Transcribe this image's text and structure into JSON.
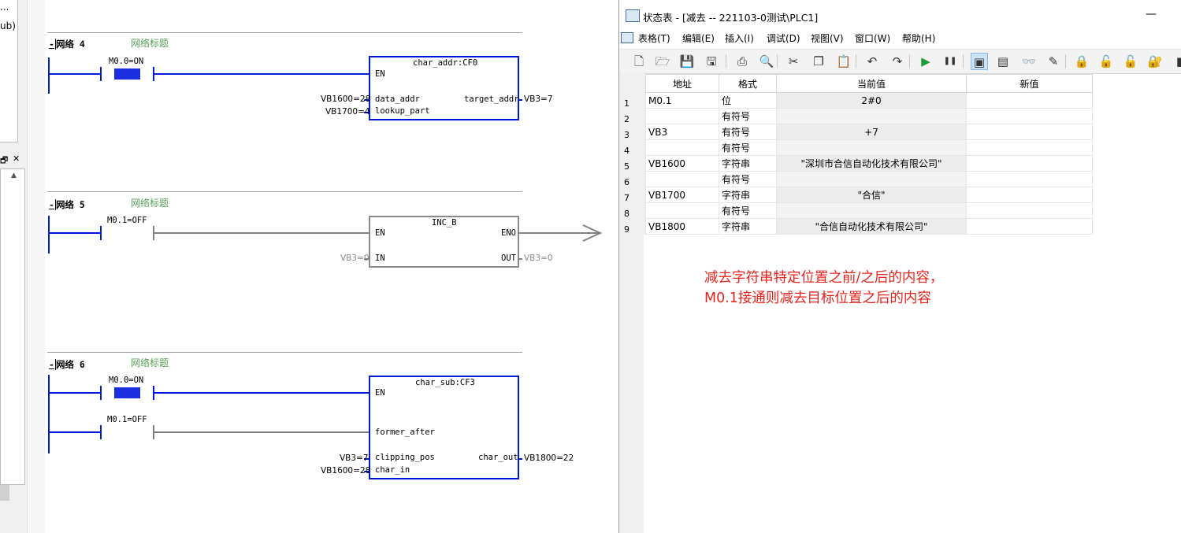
{
  "left_panel": {
    "cut_text_1": "...",
    "cut_text_2": "ub)",
    "restore_glyph": "🗗",
    "close_glyph": "✕",
    "scroll_up_glyph": "▲"
  },
  "networks": [
    {
      "label": "网络 4",
      "title": "网络标题",
      "contacts": [
        "M0.0=ON"
      ],
      "block": {
        "name": "char_addr:CF0",
        "pins_left": [
          "EN",
          "data_addr",
          "lookup_part"
        ],
        "pins_right": [
          "target_addr"
        ],
        "inputs": [
          "VB1600=28",
          "VB1700=4"
        ],
        "outputs": [
          "VB3=7"
        ]
      }
    },
    {
      "label": "网络 5",
      "title": "网络标题",
      "contacts": [
        "M0.1=OFF"
      ],
      "block": {
        "name": "INC_B",
        "pins_left": [
          "EN",
          "IN"
        ],
        "pins_right": [
          "ENO",
          "OUT"
        ],
        "inputs": [
          "VB3=0"
        ],
        "outputs": [
          "VB3=0"
        ]
      }
    },
    {
      "label": "网络 6",
      "title": "网络标题",
      "contacts": [
        "M0.0=ON",
        "M0.1=OFF"
      ],
      "block": {
        "name": "char_sub:CF3",
        "pins_left": [
          "EN",
          "former_after",
          "clipping_pos",
          "char_in"
        ],
        "pins_right": [
          "char_out"
        ],
        "inputs": [
          "VB3=7",
          "VB1600=28"
        ],
        "outputs": [
          "VB1800=22"
        ]
      }
    }
  ],
  "status_window": {
    "title": "状态表 - [减去 -- 221103-0测试\\PLC1]",
    "minimize_glyph": "—",
    "menu": [
      "表格(T)",
      "编辑(E)",
      "插入(I)",
      "调试(D)",
      "视图(V)",
      "窗口(W)",
      "帮助(H)"
    ],
    "toolbar_icons": [
      {
        "name": "new-icon",
        "glyph": "🗋"
      },
      {
        "name": "open-icon",
        "glyph": "🗁"
      },
      {
        "name": "save-icon",
        "glyph": "💾"
      },
      {
        "name": "save-all-icon",
        "glyph": "🖫"
      },
      {
        "name": "print-icon",
        "glyph": "⎙"
      },
      {
        "name": "print-preview-icon",
        "glyph": "🔍"
      },
      {
        "name": "cut-icon",
        "glyph": "✂"
      },
      {
        "name": "copy-icon",
        "glyph": "❐"
      },
      {
        "name": "paste-icon",
        "glyph": "📋"
      },
      {
        "name": "undo-icon",
        "glyph": "↶"
      },
      {
        "name": "redo-icon",
        "glyph": "↷"
      },
      {
        "name": "run-icon",
        "glyph": "▶"
      },
      {
        "name": "pause-icon",
        "glyph": "❚❚"
      },
      {
        "name": "table-monitor-icon",
        "glyph": "▣"
      },
      {
        "name": "single-read-icon",
        "glyph": "▤"
      },
      {
        "name": "glasses-icon",
        "glyph": "👓"
      },
      {
        "name": "pencil-icon",
        "glyph": "✎"
      },
      {
        "name": "force-icon",
        "glyph": "🔒"
      },
      {
        "name": "unforce-icon",
        "glyph": "🔓"
      },
      {
        "name": "unforce-all-icon",
        "glyph": "🔓"
      },
      {
        "name": "read-forced-icon",
        "glyph": "🔐"
      },
      {
        "name": "more-icon",
        "glyph": "▮"
      }
    ],
    "columns": [
      "地址",
      "格式",
      "当前值",
      "新值"
    ],
    "rows": [
      {
        "n": "1",
        "addr": "M0.1",
        "fmt": "位",
        "cur": "2#0",
        "new": ""
      },
      {
        "n": "2",
        "addr": "",
        "fmt": "有符号",
        "cur": "",
        "new": ""
      },
      {
        "n": "3",
        "addr": "VB3",
        "fmt": "有符号",
        "cur": "+7",
        "new": ""
      },
      {
        "n": "4",
        "addr": "",
        "fmt": "有符号",
        "cur": "",
        "new": ""
      },
      {
        "n": "5",
        "addr": "VB1600",
        "fmt": "字符串",
        "cur": "\"深圳市合信自动化技术有限公司\"",
        "new": ""
      },
      {
        "n": "6",
        "addr": "",
        "fmt": "有符号",
        "cur": "",
        "new": ""
      },
      {
        "n": "7",
        "addr": "VB1700",
        "fmt": "字符串",
        "cur": "\"合信\"",
        "new": ""
      },
      {
        "n": "8",
        "addr": "",
        "fmt": "有符号",
        "cur": "",
        "new": ""
      },
      {
        "n": "9",
        "addr": "VB1800",
        "fmt": "字符串",
        "cur": "\"合信自动化技术有限公司\"",
        "new": ""
      }
    ],
    "annotation_line1": "减去字符串特定位置之前/之后的内容，",
    "annotation_line2": "M0.1接通则减去目标位置之后的内容"
  },
  "colors": {
    "energized": "#0018d8",
    "deenergized": "#808080",
    "annotation": "#e8231d",
    "network_title": "#57a057"
  }
}
